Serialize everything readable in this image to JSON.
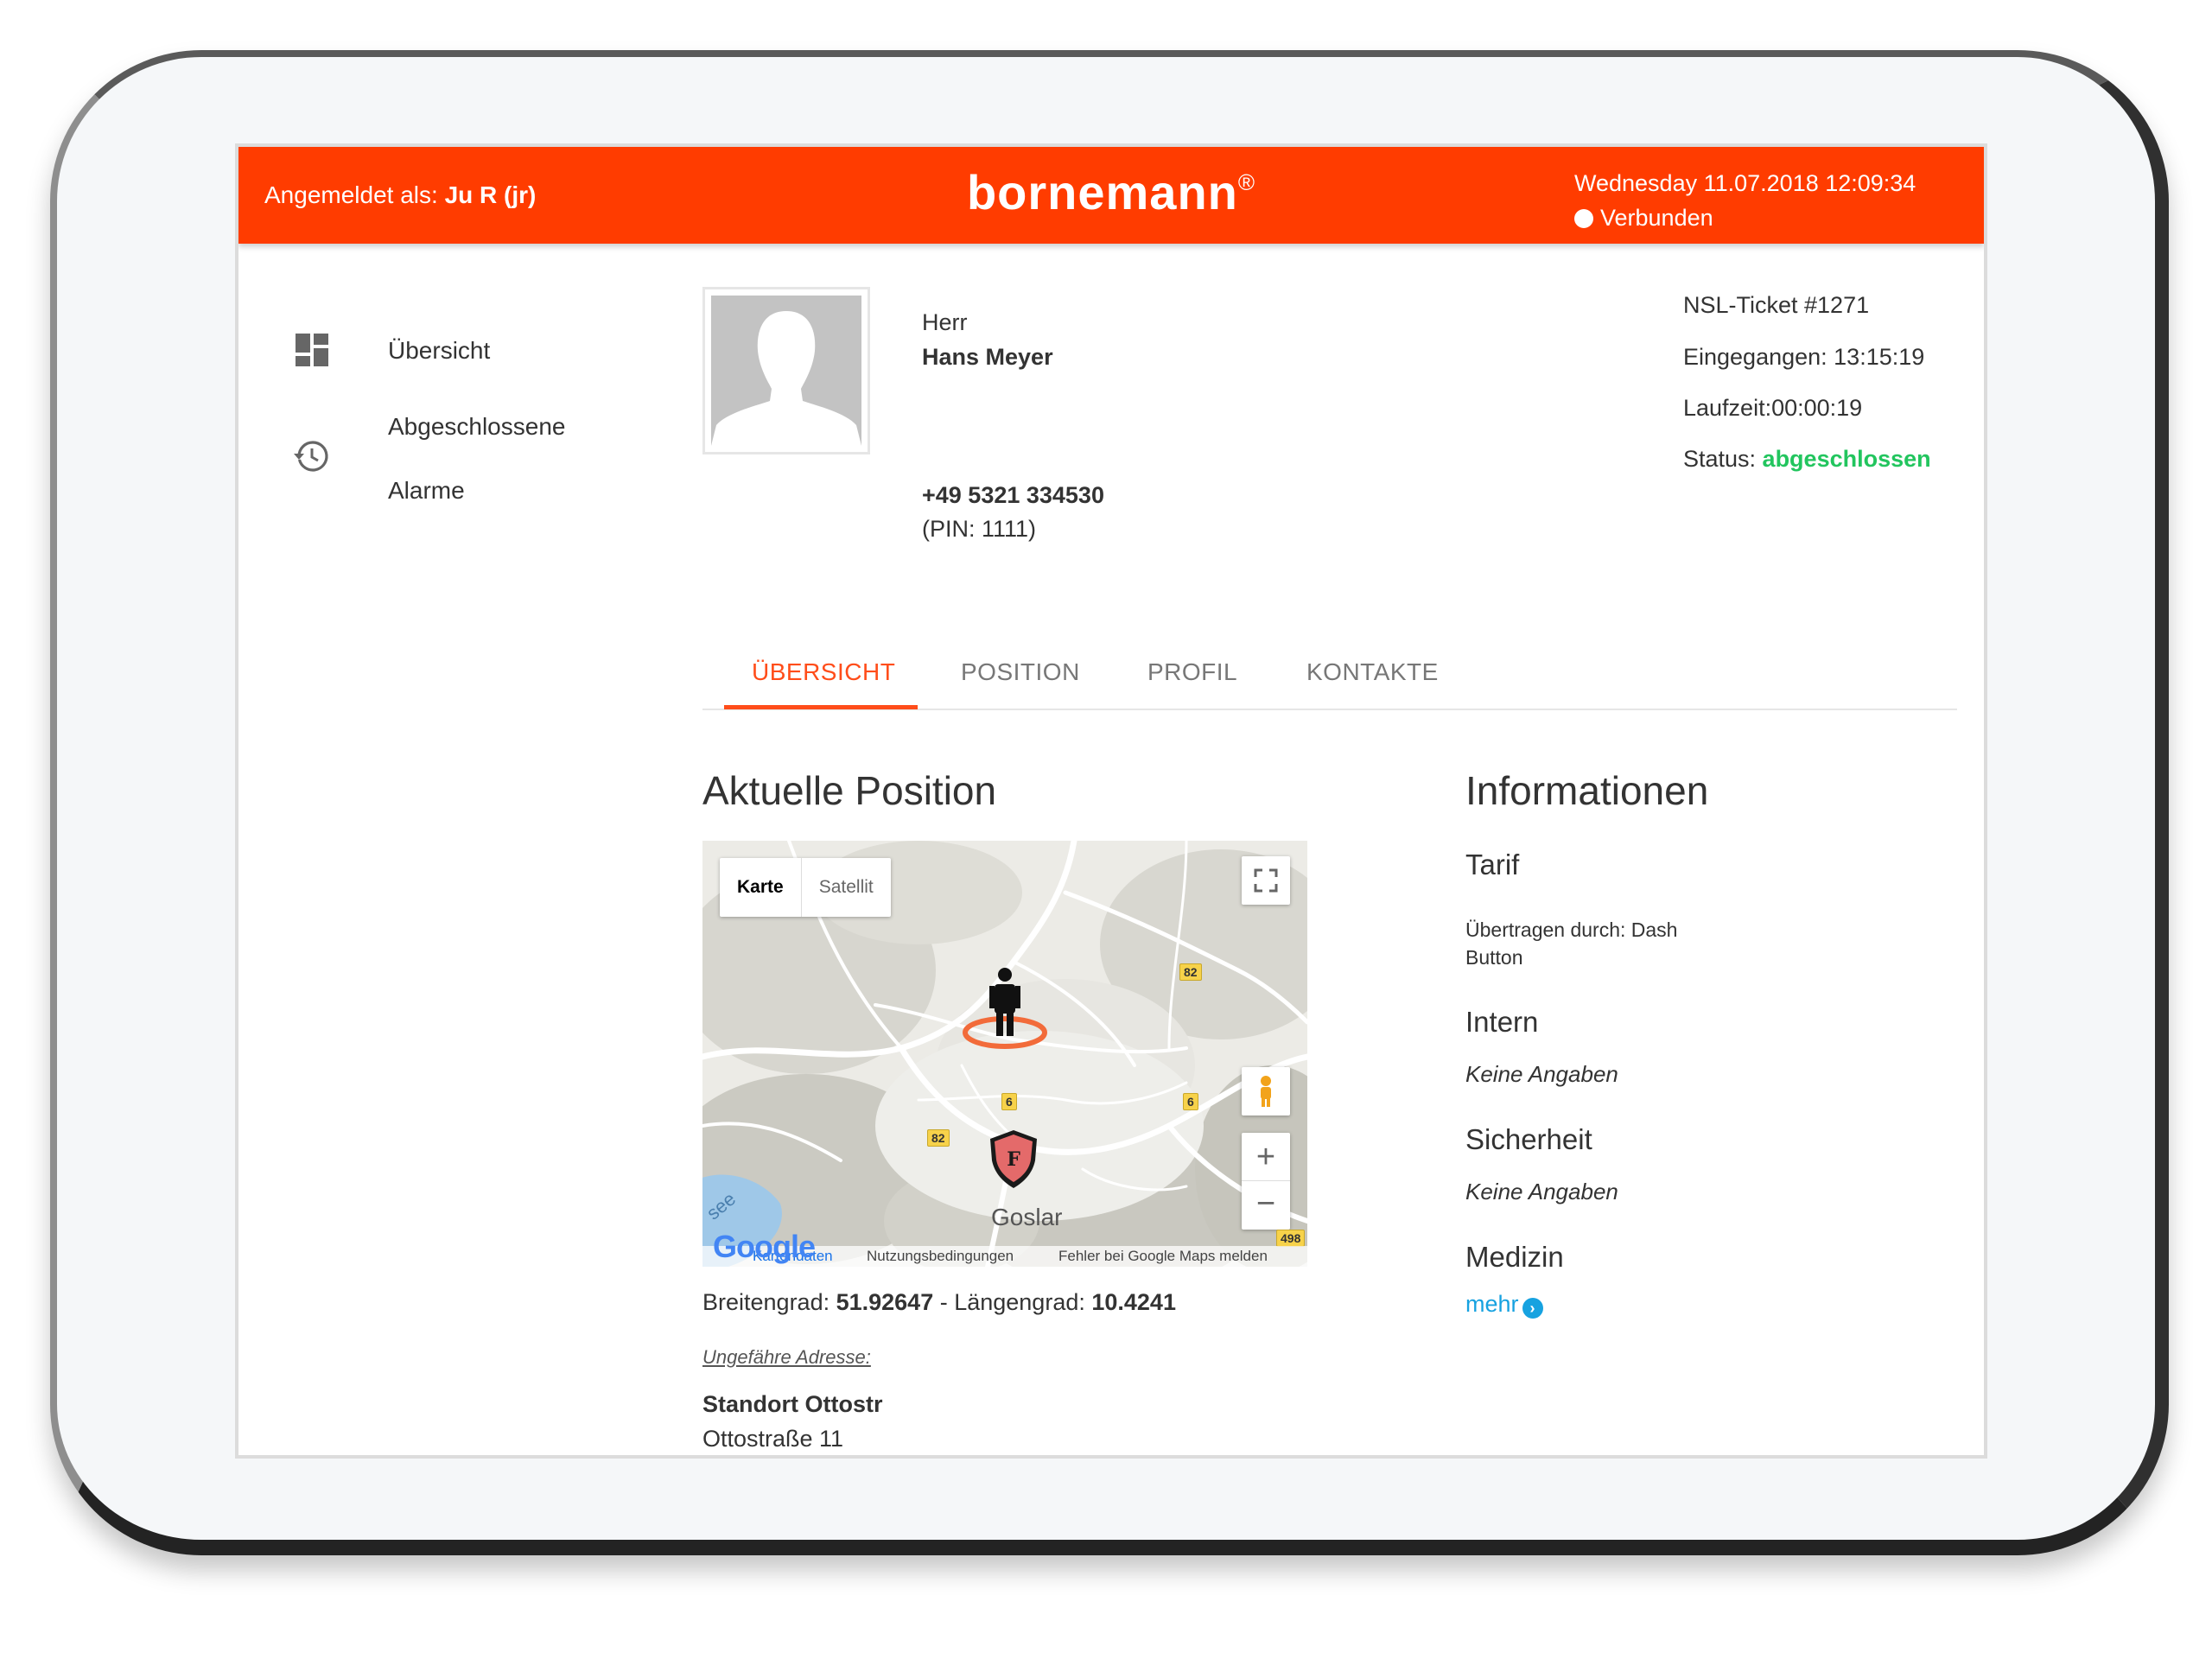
{
  "header": {
    "login_prefix": "Angemeldet als: ",
    "login_user": "Ju R (jr)",
    "logo": "bornemann",
    "logo_mark": "®",
    "datetime": "Wednesday 11.07.2018 12:09:34",
    "connection": "Verbunden"
  },
  "sidebar": {
    "items": [
      {
        "label": "Übersicht",
        "icon": "dashboard-icon"
      },
      {
        "label_line1": "Abgeschlossene",
        "label_line2": "Alarme",
        "icon": "history-icon"
      }
    ]
  },
  "person": {
    "salutation": "Herr",
    "name": "Hans Meyer",
    "phone": "+49 5321 334530",
    "pin": "(PIN: 1111)"
  },
  "ticket": {
    "number": "NSL-Ticket #1271",
    "received": "Eingegangen: 13:15:19",
    "runtime": "Laufzeit:00:00:19",
    "status_label": "Status: ",
    "status_value": "abgeschlossen"
  },
  "tabs": [
    {
      "label": "ÜBERSICHT",
      "active": true
    },
    {
      "label": "POSITION",
      "active": false
    },
    {
      "label": "PROFIL",
      "active": false
    },
    {
      "label": "KONTAKTE",
      "active": false
    }
  ],
  "position": {
    "title": "Aktuelle Position",
    "map": {
      "type_map": "Karte",
      "type_satellite": "Satellit",
      "city": "Goslar",
      "lake_label": "see",
      "roads": [
        "82",
        "6",
        "82",
        "6",
        "498"
      ],
      "google": "Google",
      "map_data": "Kartendaten",
      "terms": "Nutzungsbedingungen",
      "report": "Fehler bei Google Maps melden",
      "zoom_in": "+",
      "zoom_out": "−"
    },
    "lat_label": "Breitengrad: ",
    "lat_value": "51.92647",
    "lng_label": " - Längengrad: ",
    "lng_value": "10.4241",
    "address_label": "Ungefähre Adresse:",
    "address_name": "Standort Ottostr",
    "address_street": "Ottostraße 11"
  },
  "info": {
    "title": "Informationen",
    "tarif_title": "Tarif",
    "tarif_text": "Übertragen durch: Dash",
    "tarif_text2": "Button",
    "intern_title": "Intern",
    "intern_text": "Keine Angaben",
    "security_title": "Sicherheit",
    "security_text": "Keine Angaben",
    "medicine_title": "Medizin",
    "more": "mehr"
  },
  "colors": {
    "brand": "#ff3c00",
    "accent": "#ff4d1a",
    "status_done": "#22c55e",
    "link": "#17a2e0"
  }
}
